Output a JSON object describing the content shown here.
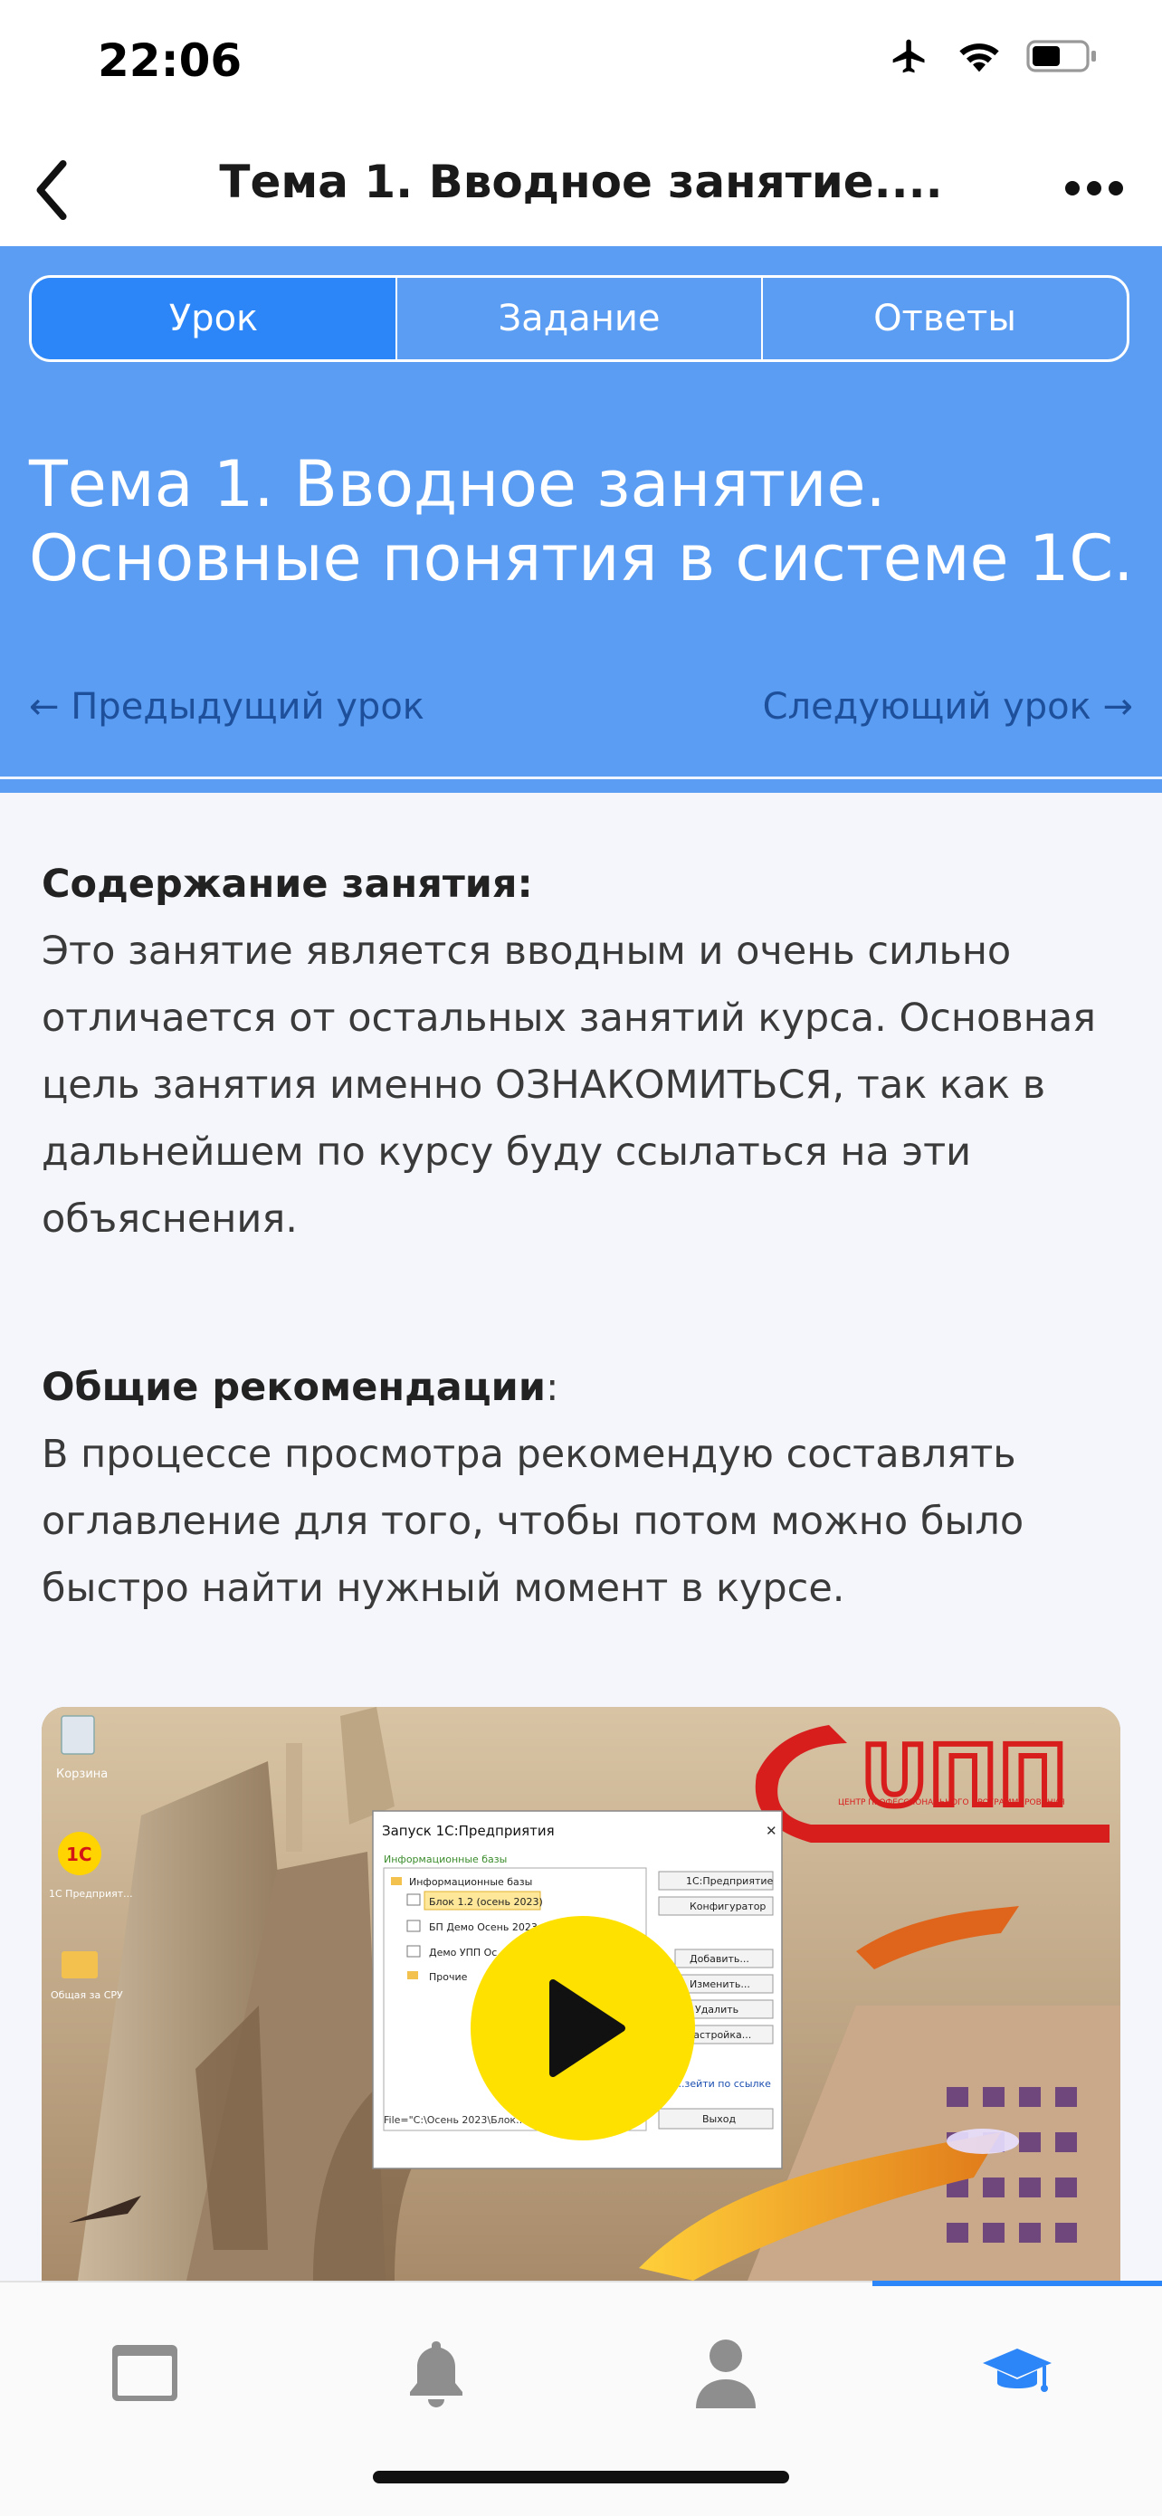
{
  "status_bar": {
    "time": "22:06"
  },
  "nav": {
    "title": "Тема 1. Вводное занятие...."
  },
  "tabs": [
    {
      "label": "Урок",
      "active": true
    },
    {
      "label": "Задание",
      "active": false
    },
    {
      "label": "Ответы",
      "active": false
    }
  ],
  "hero": {
    "title": "Тема 1. Вводное занятие. Основные понятия в системе 1С.",
    "prev_link": "← Предыдущий урок",
    "next_link": "Следующий урок →"
  },
  "content": {
    "section1_heading": "Содержание занятия:",
    "section1_text": "Это занятие является вводным и очень сильно отличается от остальных занятий курса. Основная цель занятия именно ОЗНАКОМИТЬСЯ, так как в дальнейшем по курсу буду ссылаться на эти объяснения.",
    "section2_heading": "Общие рекомендации",
    "section2_colon": ":",
    "section2_text": "В процессе просмотра рекомендую составлять оглавление для того, чтобы потом можно было быстро найти нужный момент в курсе."
  },
  "video": {
    "desktop_icons": [
      "Корзина",
      "1С Предприят...",
      "Общая за СРУ"
    ],
    "dialog_title": "Запуск 1С:Предприятия",
    "dialog_section": "Информационные базы",
    "dialog_tree_root": "Информационные базы",
    "dialog_items": [
      "Блок 1.2 (осень 2023)",
      "БП Демо Осень 2023",
      "Демо УПП Ос...",
      "Прочие"
    ],
    "dialog_buttons": [
      "1С:Предприятие",
      "Конфигуратор",
      "Добавить...",
      "Изменить...",
      "Удалить",
      "Настройка...",
      "Выход"
    ],
    "dialog_link": "...зейти по ссылке",
    "dialog_path": "File=\"C:\\Осень 2023\\Блок...",
    "logo_text": "UПП",
    "logo_subtitle": "ЦЕНТР ПРОФЕССИОНАЛЬНОГО ПРОГРАММИРОВАНИЯ",
    "accent": "#ffe100"
  },
  "tab_bar": {
    "items": [
      {
        "icon": "window-icon",
        "active": false
      },
      {
        "icon": "bell-icon",
        "active": false
      },
      {
        "icon": "person-icon",
        "active": false
      },
      {
        "icon": "graduation-cap-icon",
        "active": true
      }
    ],
    "active_color": "#2d86f7",
    "inactive_color": "#9a9a9a"
  }
}
